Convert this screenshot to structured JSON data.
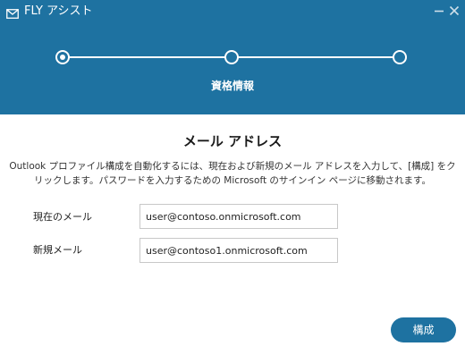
{
  "window": {
    "title": "FLY アシスト"
  },
  "stepper": {
    "steps": 3,
    "current_step": 1,
    "label": "資格情報"
  },
  "main": {
    "section_title": "メール アドレス",
    "description": "Outlook プロファイル構成を自動化するには、現在および新規のメール アドレスを入力して、[構成] をクリックします。パスワードを入力するための Microsoft のサインイン ページに移動されます。",
    "fields": {
      "current_email_label": "現在のメール",
      "current_email_value": "user@contoso.onmicrosoft.com",
      "new_email_label": "新規メール",
      "new_email_value": "user@contoso1.onmicrosoft.com"
    },
    "configure_label": "構成"
  },
  "colors": {
    "header": "#1e72a1",
    "accent": "#1e72a1"
  },
  "icons": {
    "app": "envelope-icon",
    "minimize": "minimize-icon",
    "close": "close-icon"
  }
}
